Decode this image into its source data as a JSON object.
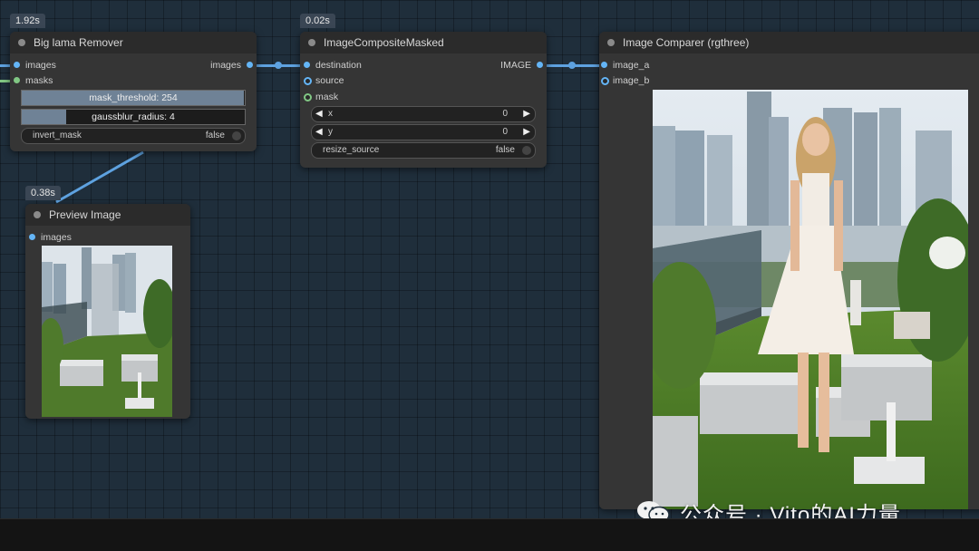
{
  "nodes": {
    "big_lama": {
      "timing": "1.92s",
      "title": "Big lama Remover",
      "inputs": [
        "images",
        "masks"
      ],
      "output": "images",
      "widgets": {
        "mask_threshold": {
          "label": "mask_threshold: 254",
          "fraction": 0.996
        },
        "gaussblur_radius": {
          "label": "gaussblur_radius: 4",
          "fraction": 0.2
        },
        "invert_mask": {
          "label": "invert_mask",
          "value": "false"
        }
      }
    },
    "composite": {
      "timing": "0.02s",
      "title": "ImageCompositeMasked",
      "inputs": [
        "destination",
        "source",
        "mask"
      ],
      "output": "IMAGE",
      "widgets": {
        "x": {
          "label": "x",
          "value": "0"
        },
        "y": {
          "label": "y",
          "value": "0"
        },
        "resize_source": {
          "label": "resize_source",
          "value": "false"
        }
      }
    },
    "comparer": {
      "title": "Image Comparer (rgthree)",
      "inputs": [
        "image_a",
        "image_b"
      ]
    },
    "preview": {
      "timing": "0.38s",
      "title": "Preview Image",
      "inputs": [
        "images"
      ]
    }
  },
  "watermark": "公众号 · Vito的AI力量",
  "colors": {
    "image_slot": "#64b5f6",
    "mask_slot": "#81c784",
    "wire": "#5ea2e0",
    "canvas": "#1f2e3b",
    "node_body": "#353535"
  },
  "icons": [
    "wechat-icon",
    "left-arrow-icon",
    "right-arrow-icon"
  ]
}
